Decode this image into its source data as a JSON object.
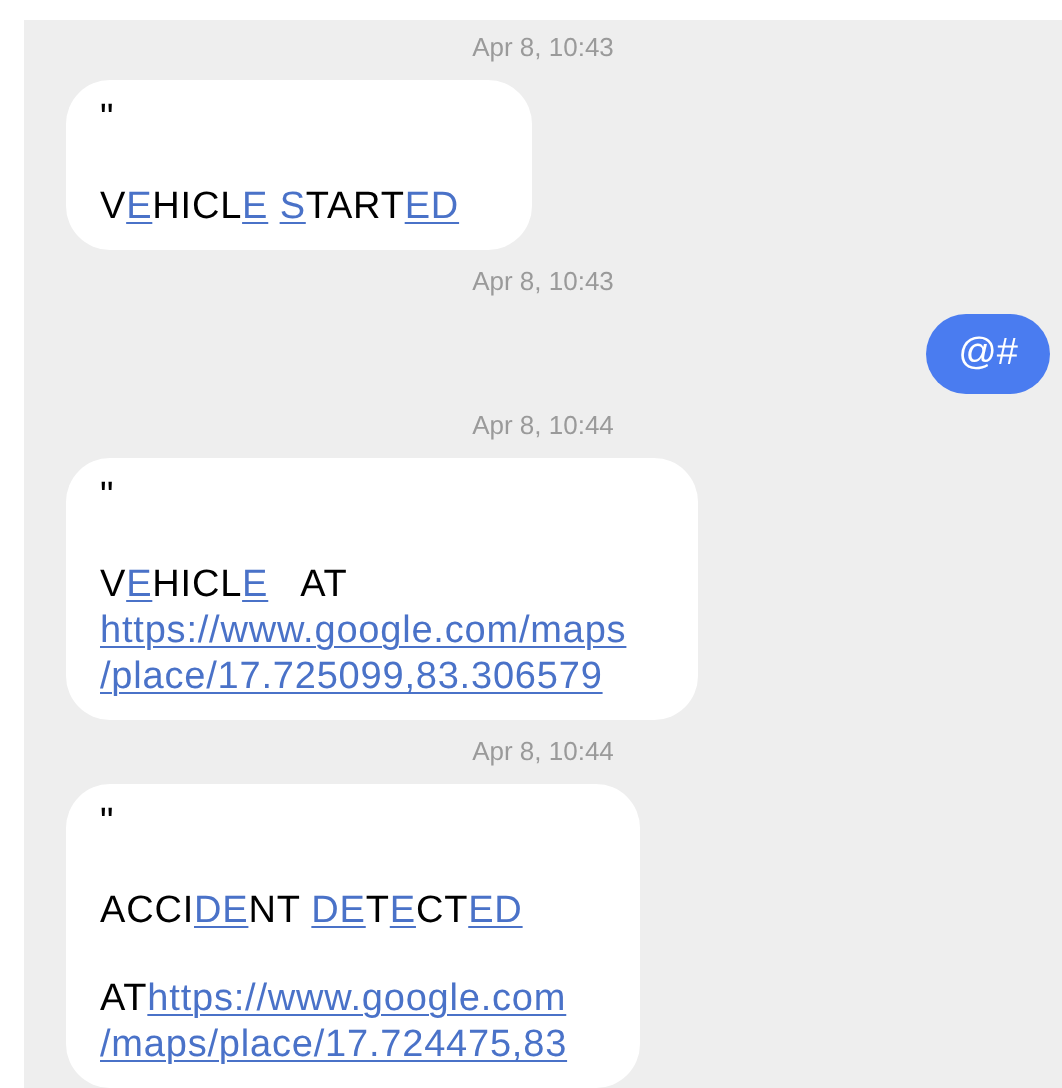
{
  "messages": [
    {
      "kind": "timestamp",
      "text": "Apr 8, 10:43"
    },
    {
      "kind": "received",
      "paragraphs": [
        [
          [
            {
              "kind": "plain",
              "text": "\""
            }
          ]
        ],
        [
          [
            {
              "kind": "plain",
              "text": "V"
            },
            {
              "kind": "link",
              "text": "E"
            },
            {
              "kind": "plain",
              "text": "HICL"
            },
            {
              "kind": "link",
              "text": "E"
            },
            {
              "kind": "link",
              "text": "S",
              "space_before": true
            },
            {
              "kind": "plain",
              "text": "TART"
            },
            {
              "kind": "link",
              "text": "ED"
            }
          ]
        ]
      ]
    },
    {
      "kind": "timestamp",
      "text": "Apr 8, 10:43"
    },
    {
      "kind": "sent",
      "text": "@#"
    },
    {
      "kind": "timestamp",
      "text": "Apr 8, 10:44"
    },
    {
      "kind": "received",
      "paragraphs": [
        [
          [
            {
              "kind": "plain",
              "text": "\""
            }
          ]
        ],
        [
          [
            {
              "kind": "plain",
              "text": "V"
            },
            {
              "kind": "link",
              "text": "E"
            },
            {
              "kind": "plain",
              "text": "HICL"
            },
            {
              "kind": "link",
              "text": "E"
            },
            {
              "kind": "plain",
              "text": "   AT"
            }
          ],
          [
            {
              "kind": "link",
              "text": "https://www.google.com/maps"
            }
          ],
          [
            {
              "kind": "link",
              "text": "/place/17.725099,83.306579"
            }
          ]
        ]
      ]
    },
    {
      "kind": "timestamp",
      "text": "Apr 8, 10:44"
    },
    {
      "kind": "received",
      "paragraphs": [
        [
          [
            {
              "kind": "plain",
              "text": "\""
            }
          ]
        ],
        [
          [
            {
              "kind": "plain",
              "text": "ACCI"
            },
            {
              "kind": "link",
              "text": "DE"
            },
            {
              "kind": "plain",
              "text": "NT "
            },
            {
              "kind": "link",
              "text": "DE"
            },
            {
              "kind": "plain",
              "text": "T"
            },
            {
              "kind": "link",
              "text": "E"
            },
            {
              "kind": "plain",
              "text": "CT"
            },
            {
              "kind": "link",
              "text": "ED"
            }
          ]
        ],
        [
          [
            {
              "kind": "plain",
              "text": "AT"
            },
            {
              "kind": "link",
              "text": "https://www.google.com"
            }
          ],
          [
            {
              "kind": "link",
              "text": "/maps/place/17.724475,83"
            }
          ]
        ]
      ]
    }
  ]
}
